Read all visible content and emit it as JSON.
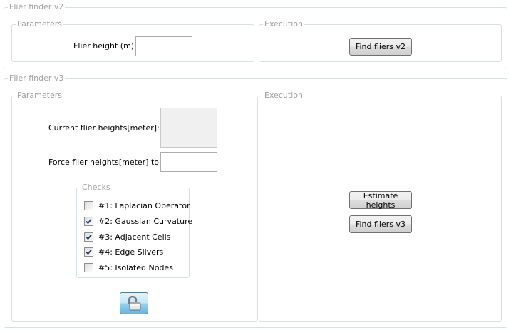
{
  "v2": {
    "title": "Flier finder v2",
    "parameters": {
      "title": "Parameters",
      "height_label": "Flier height (m):",
      "height_value": ""
    },
    "execution": {
      "title": "Execution",
      "find_button": "Find fliers v2"
    }
  },
  "v3": {
    "title": "Flier finder v3",
    "parameters": {
      "title": "Parameters",
      "current_label": "Current flier heights[meter]:",
      "current_value": "",
      "force_label": "Force flier heights[meter] to:",
      "force_value": ""
    },
    "checks": {
      "title": "Checks",
      "items": [
        {
          "label": "#1: Laplacian Operator",
          "checked": false
        },
        {
          "label": "#2: Gaussian Curvature",
          "checked": true
        },
        {
          "label": "#3: Adjacent Cells",
          "checked": true
        },
        {
          "label": "#4: Edge Slivers",
          "checked": true
        },
        {
          "label": "#5: Isolated Nodes",
          "checked": false
        }
      ]
    },
    "lock_button_icon": "unlocked-padlock-icon",
    "execution": {
      "title": "Execution",
      "estimate_button": "Estimate heights",
      "find_button": "Find fliers v3"
    }
  }
}
